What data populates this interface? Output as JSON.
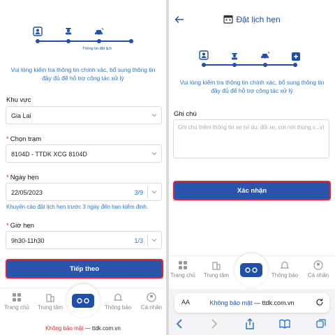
{
  "left": {
    "stepper": {
      "caption": "Thông tin đặt lịch"
    },
    "notice": "Vui lòng kiểm tra thông tin chính xác, bổ sung thông tin đầy đủ để hỗ trợ công tác xử lý",
    "region": {
      "label": "Khu vực",
      "value": "Gia Lai"
    },
    "station": {
      "label": "Chọn trạm",
      "value": "8104D - TTDK XCG 8104D"
    },
    "date": {
      "label": "Ngày hẹn",
      "value": "22/05/2023",
      "count": "3/9"
    },
    "warning": "Khuyến cáo đặt lịch hẹn trước 3 ngày đến hạn kiểm định.",
    "time": {
      "label": "Giờ hẹn",
      "value": "9h30-11h30",
      "count": "1/3"
    },
    "next_button": "Tiếp theo",
    "tabs": [
      "Trang chủ",
      "Trung tâm",
      "Thông báo",
      "Cá nhân"
    ],
    "url": {
      "security": "Không bảo mật",
      "separator": "—",
      "domain": "ttdk.com.vn"
    }
  },
  "right": {
    "title": "Đặt lịch hẹn",
    "notice": "Vui lòng kiểm tra thông tin chính xác, bổ sung thông tin đầy đủ để hỗ trợ công tác xử lý",
    "note": {
      "label": "Ghi chú",
      "placeholder": "Ghi chú thêm thông tin xe (ví dụ: đổi xe, cơi nới thùng,v...v)"
    },
    "confirm_button": "Xác nhận",
    "tabs": [
      "Trang chủ",
      "Trung tâm",
      "Thông báo",
      "Cá nhân"
    ],
    "safari": {
      "aa": "AA",
      "security": "Không bảo mật",
      "separator": "—",
      "domain": "ttdk.com.vn"
    }
  },
  "colors": {
    "primary": "#2a55ad",
    "accent": "#1f4fa8",
    "link": "#2d74c9",
    "highlight": "#d8283a"
  }
}
